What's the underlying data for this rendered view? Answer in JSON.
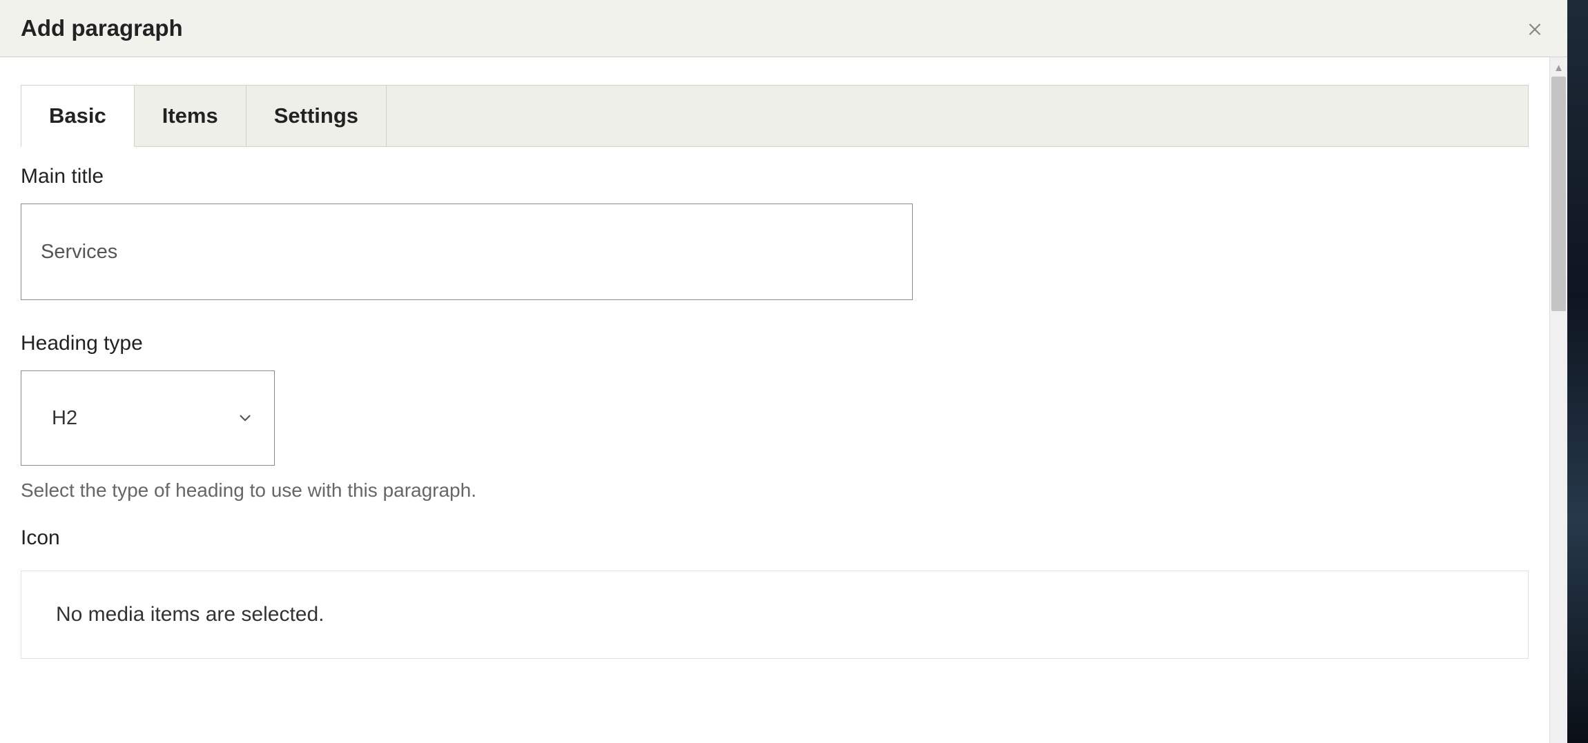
{
  "modal": {
    "title": "Add paragraph"
  },
  "tabs": [
    {
      "label": "Basic"
    },
    {
      "label": "Items"
    },
    {
      "label": "Settings"
    }
  ],
  "form": {
    "main_title": {
      "label": "Main title",
      "value": "Services"
    },
    "heading_type": {
      "label": "Heading type",
      "value": "H2",
      "help": "Select the type of heading to use with this paragraph."
    },
    "icon": {
      "label": "Icon",
      "empty_message": "No media items are selected."
    }
  }
}
